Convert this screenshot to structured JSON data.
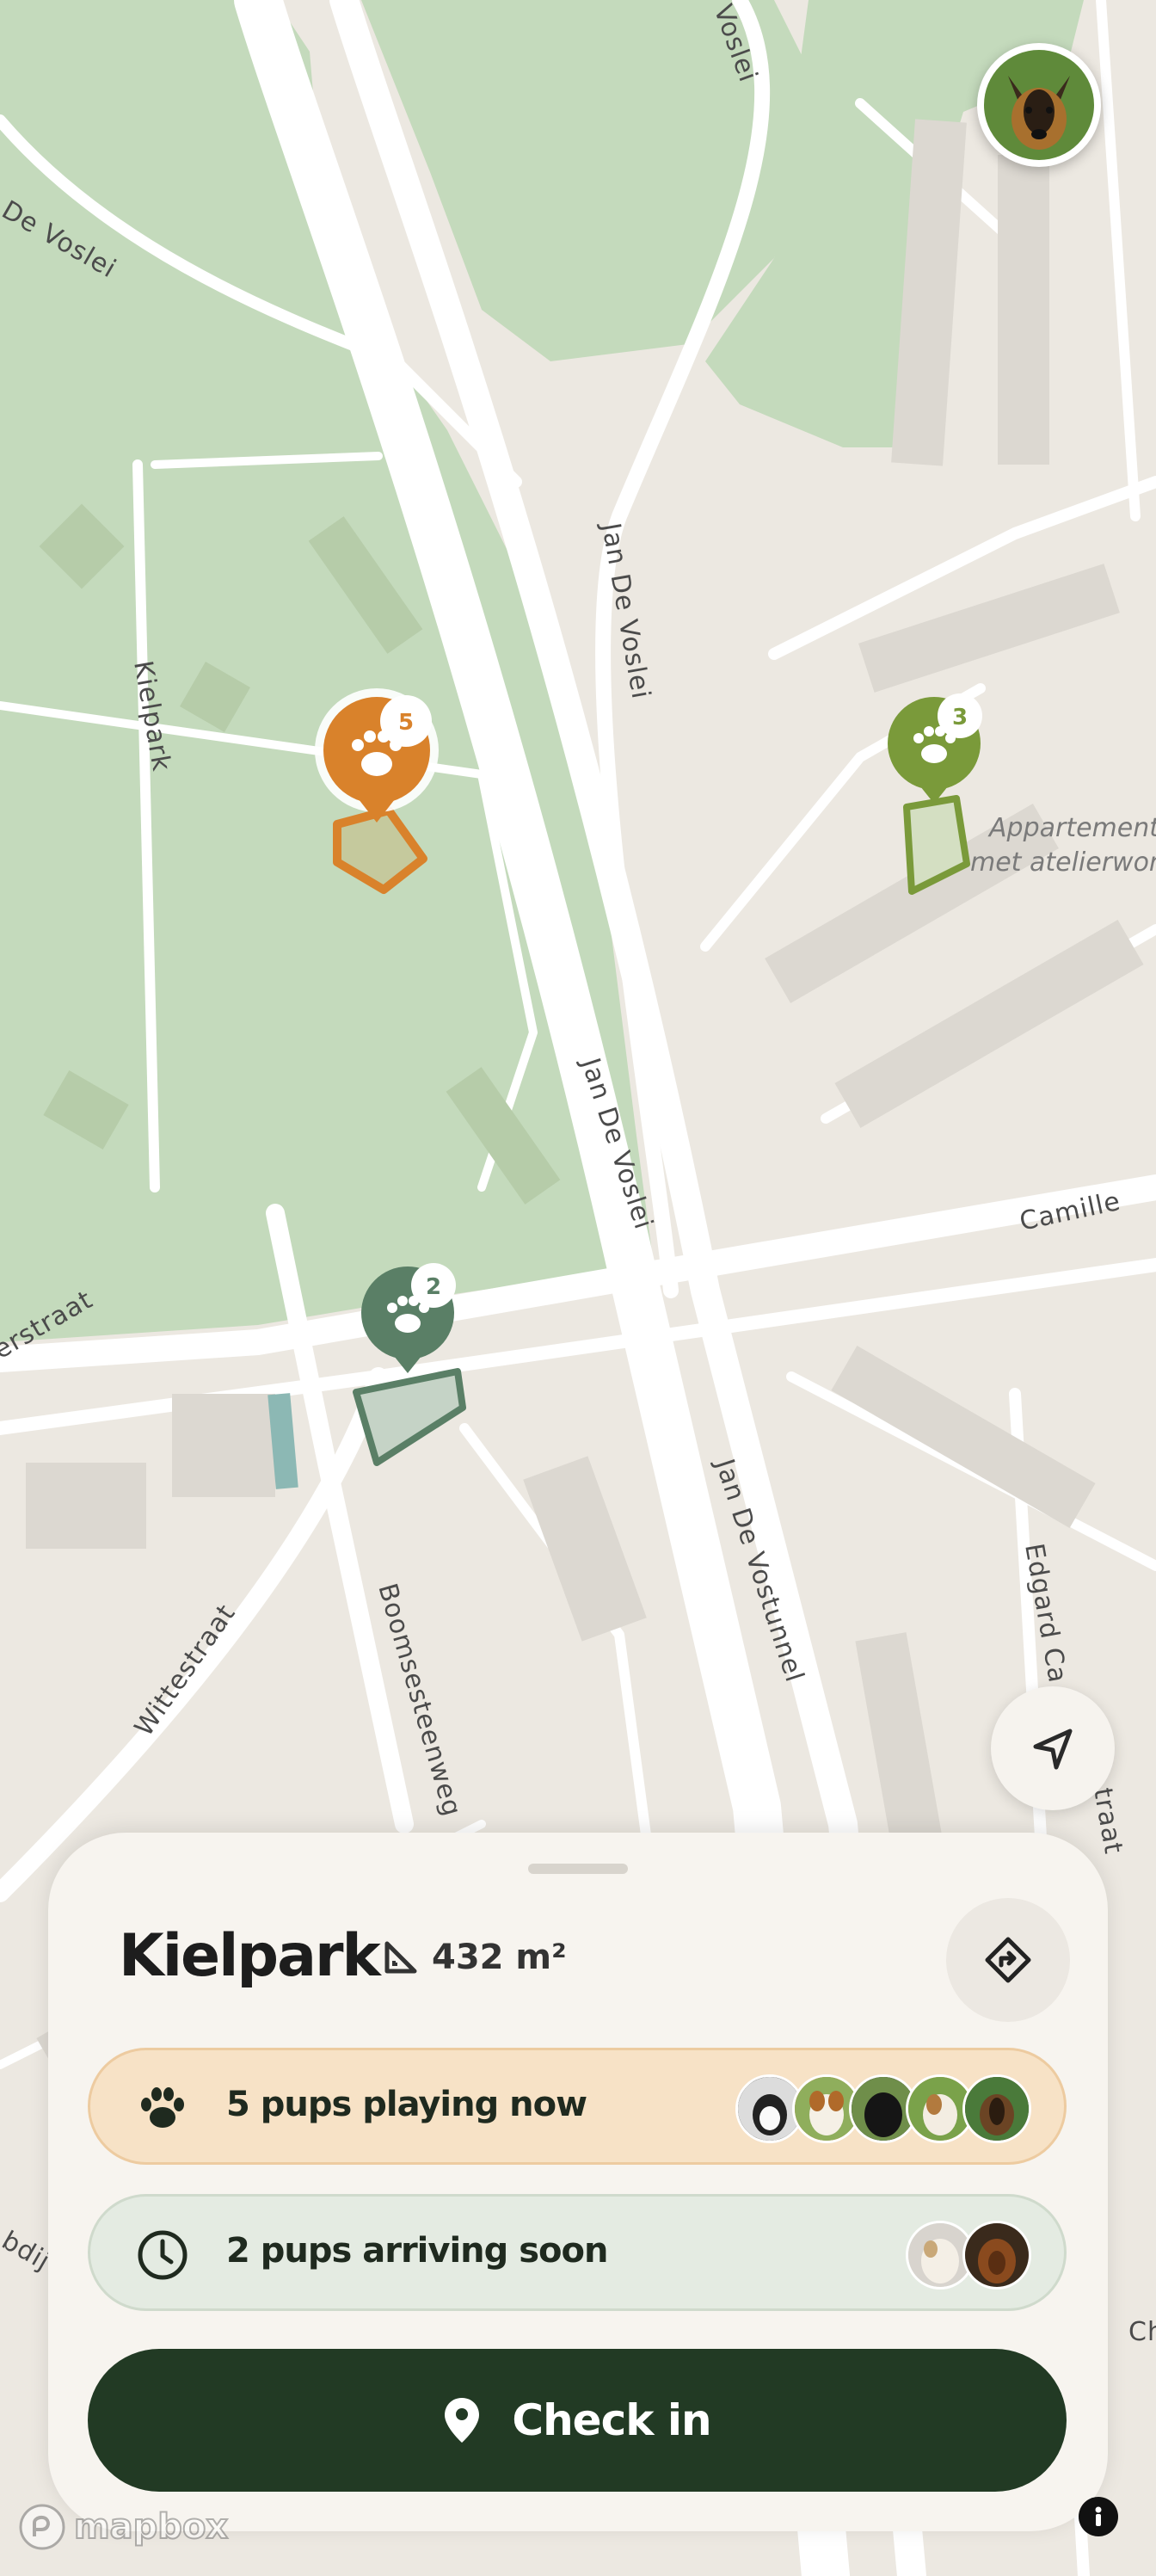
{
  "map": {
    "street_labels": [
      "De Voslei",
      "Voslei",
      "Kielpark",
      "Jan De Voslei",
      "Jan De Voslei",
      "Camille",
      "Jan De Vostunnel",
      "Edgard Ca",
      "traat",
      "erstraat",
      "Wittestraat",
      "Boomsesteenweg",
      "bdij",
      "Ch"
    ],
    "poi_label_lines": [
      "Appartement",
      "met atelierwon"
    ],
    "pins": [
      {
        "name": "kielpark-pin",
        "count": "5",
        "color": "#d9822b",
        "status": "active"
      },
      {
        "name": "green-pin",
        "count": "3",
        "color": "#7a9a3a",
        "status": "inactive"
      },
      {
        "name": "teal-pin",
        "count": "2",
        "color": "#5a7f66",
        "status": "inactive"
      }
    ],
    "attribution_text": "mapbox",
    "colors": {
      "park": "#c4dabc",
      "land": "#ece8e1",
      "road": "#ffffff"
    }
  },
  "profile": {
    "avatar_icon": "german-shepherd-avatar"
  },
  "sheet": {
    "title": "Kielpark",
    "area_icon": "ruler-triangle-icon",
    "area": "432 m²",
    "directions_icon": "directions-icon",
    "playing": {
      "label": "5 pups playing now",
      "icon": "paw-icon",
      "dog_avatars": [
        "border-collie",
        "beagle",
        "black-lab",
        "jack-russell",
        "dachshund"
      ]
    },
    "arriving": {
      "label": "2 pups arriving soon",
      "icon": "clock-icon",
      "dog_avatars": [
        "terrier",
        "dachshund"
      ]
    },
    "checkin": {
      "label": "Check in",
      "icon": "location-pin-icon"
    }
  },
  "colors": {
    "accent_orange": "#d9822b",
    "dark_green": "#223a24",
    "playing_bg": "#f7e2c6",
    "arriving_bg": "#e4ebe2"
  }
}
